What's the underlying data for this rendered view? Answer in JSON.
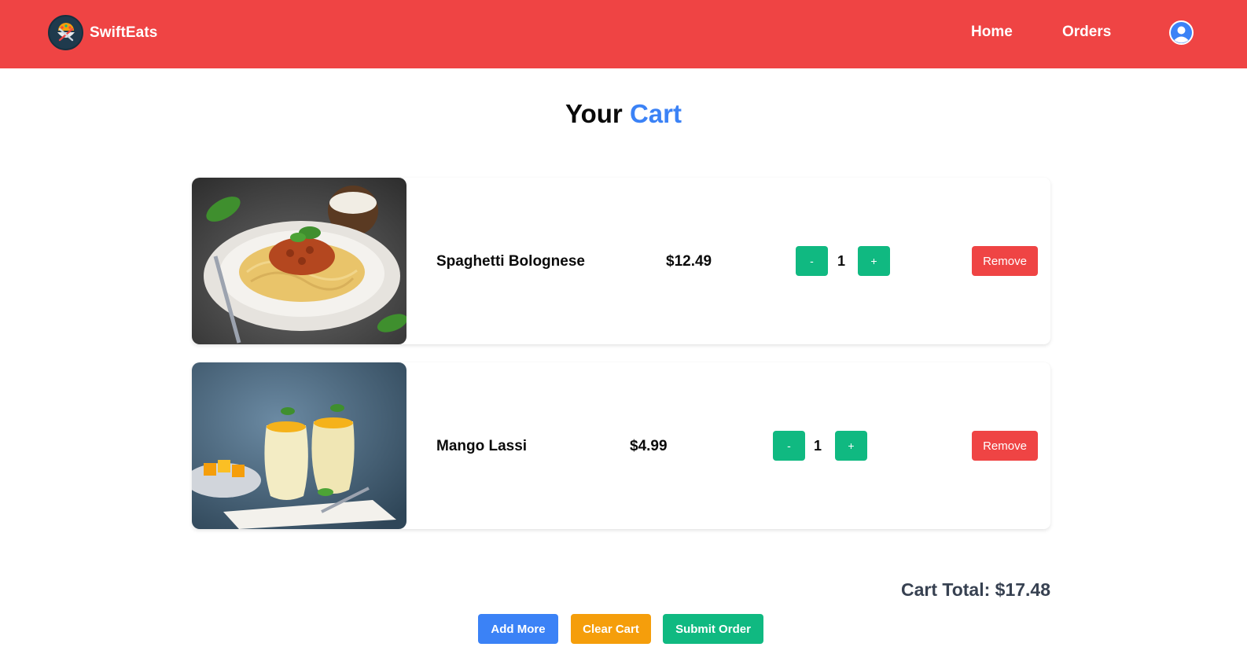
{
  "header": {
    "brand_name": "SwiftEats",
    "nav": {
      "home": "Home",
      "orders": "Orders"
    },
    "logo_icon": "fork-knife-logo-icon",
    "profile_icon": "user-avatar-icon",
    "background_color": "#ef4444"
  },
  "page": {
    "title_prefix": "Your",
    "title_accent": "Cart",
    "accent_color": "#3b82f6"
  },
  "cart": {
    "items": [
      {
        "name": "Spaghetti Bolognese",
        "price": "$12.49",
        "quantity": "1",
        "decrement_label": "-",
        "increment_label": "+",
        "remove_label": "Remove",
        "image_subject": "spaghetti-bolognese-photo"
      },
      {
        "name": "Mango Lassi",
        "price": "$4.99",
        "quantity": "1",
        "decrement_label": "-",
        "increment_label": "+",
        "remove_label": "Remove",
        "image_subject": "mango-lassi-photo"
      }
    ],
    "total_text": "Cart Total: $17.48"
  },
  "actions": {
    "add_more": "Add More",
    "clear_cart": "Clear Cart",
    "submit_order": "Submit Order"
  },
  "colors": {
    "primary_red": "#ef4444",
    "green": "#10b981",
    "orange": "#f59e0b",
    "blue": "#3b82f6"
  }
}
